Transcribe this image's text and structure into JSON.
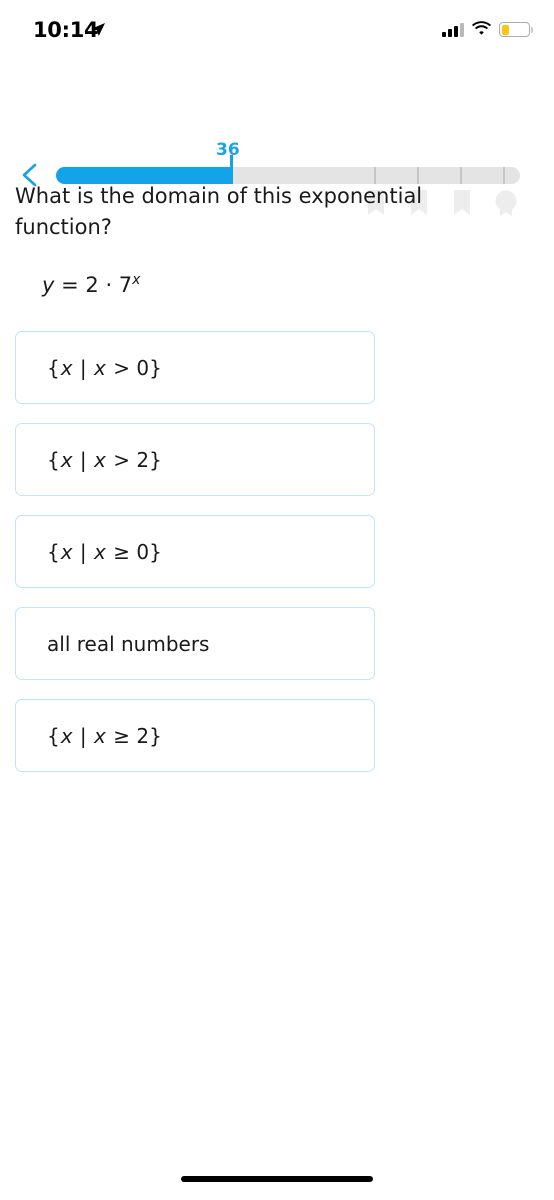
{
  "status_bar": {
    "time": "10:14",
    "location_icon": "location-arrow-icon",
    "signal_icon": "cellular-signal-icon",
    "wifi_icon": "wifi-icon",
    "battery_icon": "battery-low-power-icon",
    "battery_color": "#fcc418"
  },
  "header": {
    "back_icon": "chevron-left-icon",
    "progress_value": "36",
    "progress_percent": 37.7,
    "accent_color": "#12a3e8",
    "track_color": "#e4e4e4",
    "milestones": [
      {
        "icon": "ribbon-badge-icon"
      },
      {
        "icon": "ribbon-badge-icon"
      },
      {
        "icon": "ribbon-badge-icon"
      },
      {
        "icon": "trophy-medal-icon"
      }
    ]
  },
  "question": {
    "prompt": "What is the domain of this exponential function?",
    "equation": {
      "lhs": "y",
      "relation": " = ",
      "coefficient": "2",
      "operator": " · ",
      "base": "7",
      "exponent": "x"
    }
  },
  "options": [
    {
      "id": "opt-1",
      "text": "{x | x > 0}",
      "prefix": "{",
      "var1": "x",
      "mid": " | ",
      "var2": "x",
      "rel": " > 0}"
    },
    {
      "id": "opt-2",
      "text": "{x | x > 2}",
      "prefix": "{",
      "var1": "x",
      "mid": " | ",
      "var2": "x",
      "rel": " > 2}"
    },
    {
      "id": "opt-3",
      "text": "{x | x ≥ 0}",
      "prefix": "{",
      "var1": "x",
      "mid": " | ",
      "var2": "x",
      "rel": " ≥ 0}"
    },
    {
      "id": "opt-4",
      "text": "all real numbers",
      "plain": true
    },
    {
      "id": "opt-5",
      "text": "{x | x ≥ 2}",
      "prefix": "{",
      "var1": "x",
      "mid": " | ",
      "var2": "x",
      "rel": " ≥ 2}"
    }
  ],
  "border_color": "#bfe5f8"
}
